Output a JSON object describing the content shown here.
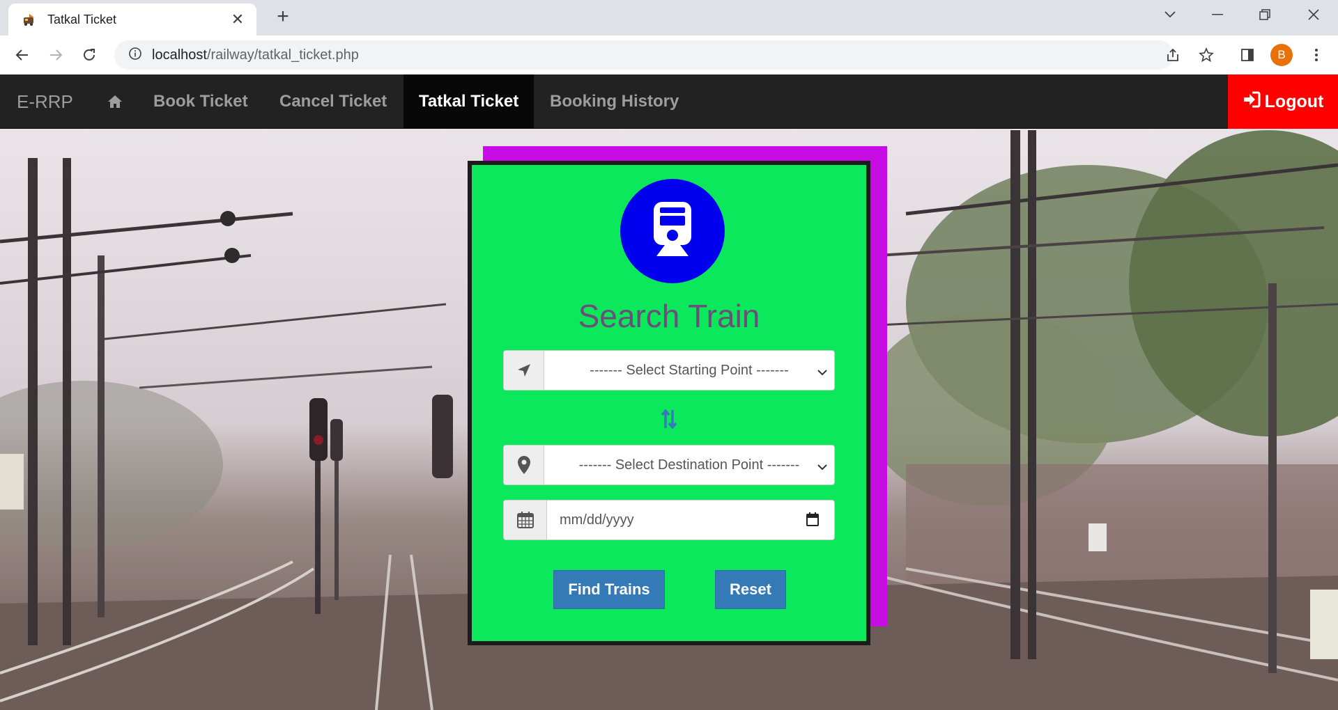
{
  "browser": {
    "tab_title": "Tatkal Ticket",
    "tab_close": "✕",
    "new_tab": "+",
    "url_host": "localhost",
    "url_path": "/railway/tatkal_ticket.php",
    "profile_initial": "B"
  },
  "navbar": {
    "brand": "E-RRP",
    "links": [
      {
        "label": "Book Ticket"
      },
      {
        "label": "Cancel Ticket"
      },
      {
        "label": "Tatkal Ticket",
        "active": true
      },
      {
        "label": "Booking History"
      }
    ],
    "logout_label": "Logout",
    "colors": {
      "bar": "#222222",
      "active": "#080808",
      "logout": "#ff0000"
    }
  },
  "search_form": {
    "title": "Search Train",
    "start_select": "------- Select Starting Point -------",
    "destination_select": "------- Select Destination Point -------",
    "date_placeholder": "mm/dd/yyyy",
    "find_button": "Find Trains",
    "reset_button": "Reset",
    "colors": {
      "card": "#0ce85b",
      "shadow": "#c70ce4",
      "logo": "#0000ee",
      "button": "#337ab7"
    }
  },
  "icons": [
    "train-icon",
    "home-icon",
    "sign-in-icon",
    "location-arrow-icon",
    "swap-icon",
    "map-marker-icon",
    "calendar-icon"
  ]
}
